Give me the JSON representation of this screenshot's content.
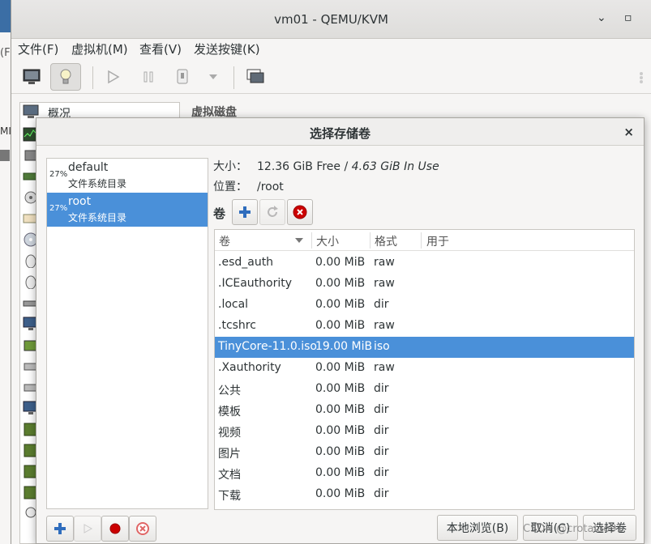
{
  "background": {
    "left_fragment_1": "(F",
    "left_fragment_2": "MI"
  },
  "window": {
    "title": "vm01 - QEMU/KVM",
    "minimize_glyph": "⌄",
    "maximize_glyph": "▫"
  },
  "menubar": {
    "file": "文件(F)",
    "vm": "虚拟机(M)",
    "view": "查看(V)",
    "sendkey": "发送按键(K)"
  },
  "vm_sidebar": {
    "first_item": "概况"
  },
  "vm_main": {
    "section_label": "虚拟磁盘"
  },
  "dialog": {
    "title": "选择存储卷",
    "close_glyph": "×",
    "size_label": "大小：",
    "size_free": "12.36 GiB Free / ",
    "size_inuse": "4.63 GiB In Use",
    "location_label": "位置：",
    "location_value": "/root",
    "volumes_label": "卷",
    "pools": [
      {
        "percent": "27%",
        "name": "default",
        "type": "文件系统目录"
      },
      {
        "percent": "27%",
        "name": "root",
        "type": "文件系统目录"
      }
    ],
    "selected_pool": "root",
    "columns": {
      "name": "卷",
      "size": "大小",
      "format": "格式",
      "used_by": "用于"
    },
    "volumes": [
      {
        "name": ".esd_auth",
        "size": "0.00 MiB",
        "format": "raw",
        "used_by": ""
      },
      {
        "name": ".ICEauthority",
        "size": "0.00 MiB",
        "format": "raw",
        "used_by": ""
      },
      {
        "name": ".local",
        "size": "0.00 MiB",
        "format": "dir",
        "used_by": ""
      },
      {
        "name": ".tcshrc",
        "size": "0.00 MiB",
        "format": "raw",
        "used_by": ""
      },
      {
        "name": "TinyCore-11.0.iso",
        "size": "19.00 MiB",
        "format": "iso",
        "used_by": ""
      },
      {
        "name": ".Xauthority",
        "size": "0.00 MiB",
        "format": "raw",
        "used_by": ""
      },
      {
        "name": "公共",
        "size": "0.00 MiB",
        "format": "dir",
        "used_by": ""
      },
      {
        "name": "模板",
        "size": "0.00 MiB",
        "format": "dir",
        "used_by": ""
      },
      {
        "name": "视频",
        "size": "0.00 MiB",
        "format": "dir",
        "used_by": ""
      },
      {
        "name": "图片",
        "size": "0.00 MiB",
        "format": "dir",
        "used_by": ""
      },
      {
        "name": "文档",
        "size": "0.00 MiB",
        "format": "dir",
        "used_by": ""
      },
      {
        "name": "下载",
        "size": "0.00 MiB",
        "format": "dir",
        "used_by": ""
      }
    ],
    "selected_volume": "TinyCore-11.0.iso",
    "browse_local": "本地浏览(B)",
    "cancel": "取消(C)",
    "choose": "选择卷"
  },
  "watermark": "CSDN @crotaldo91",
  "colors": {
    "selection": "#4a90d9",
    "add_icon": "#2f6dbd",
    "stop_red": "#cc0000"
  }
}
